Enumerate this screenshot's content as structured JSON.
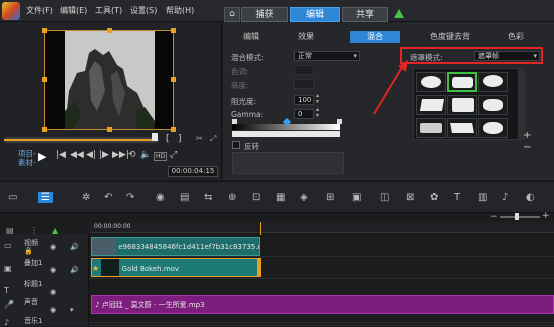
{
  "menu": {
    "items": [
      "文件(F)",
      "编辑(E)",
      "工具(T)",
      "设置(S)",
      "帮助(H)"
    ]
  },
  "tabs": {
    "capture": "捕获",
    "edit": "编辑",
    "share": "共享"
  },
  "player": {
    "project_label": "项目-",
    "clip_label": "素材-",
    "timecode": "00:00:04:15",
    "hd_label": "HD",
    "bracket_in": "[",
    "bracket_out": "]",
    "buttons": {
      "play": "▶",
      "home": "|◀",
      "prev": "◀◀",
      "step_back": "◀|",
      "step_fwd": "|▶",
      "next": "▶▶|",
      "loop": "⟲",
      "volume": "🔈",
      "fullscreen": "⤢"
    }
  },
  "attributes": {
    "subtabs": [
      "编辑",
      "效果",
      "混合",
      "色度键去背",
      "色彩"
    ],
    "active_subtab": "混合",
    "blend_mode_label": "混合模式:",
    "blend_mode_value": "正常",
    "hue_label": "色调:",
    "saturation_label": "高度:",
    "opacity_label": "阻光度:",
    "opacity_value": "100",
    "gamma_label": "Gamma:",
    "gamma_value": "0",
    "invert_label": "反转",
    "mask_mode_label": "遮罩模式:",
    "mask_mode_value": "遮罩帧",
    "add_icon": "+",
    "remove_icon": "−"
  },
  "timeline": {
    "tracks": [
      {
        "name": "视频",
        "sub": ""
      },
      {
        "name": "叠加1",
        "sub": ""
      },
      {
        "name": "标题1",
        "sub": ""
      },
      {
        "name": "声音",
        "sub": ""
      },
      {
        "name": "音乐1",
        "sub": ""
      }
    ],
    "ruler_time": "00:00:00:00",
    "clips": {
      "video": "e968334845846fc1d411ef7b31c83735.mp4",
      "overlay": "Gold Bokeh.mov",
      "music": "卢冠廷 _ 莫文蔚 - 一生所爱.mp3"
    },
    "zoom_minus": "−",
    "zoom_plus": "+"
  },
  "colors": {
    "accent": "#2e86d6",
    "overlay_clip": "#1d7a74",
    "video_clip": "#1f6d6a",
    "music_clip": "#7d1e7e",
    "highlight": "#e02525"
  }
}
